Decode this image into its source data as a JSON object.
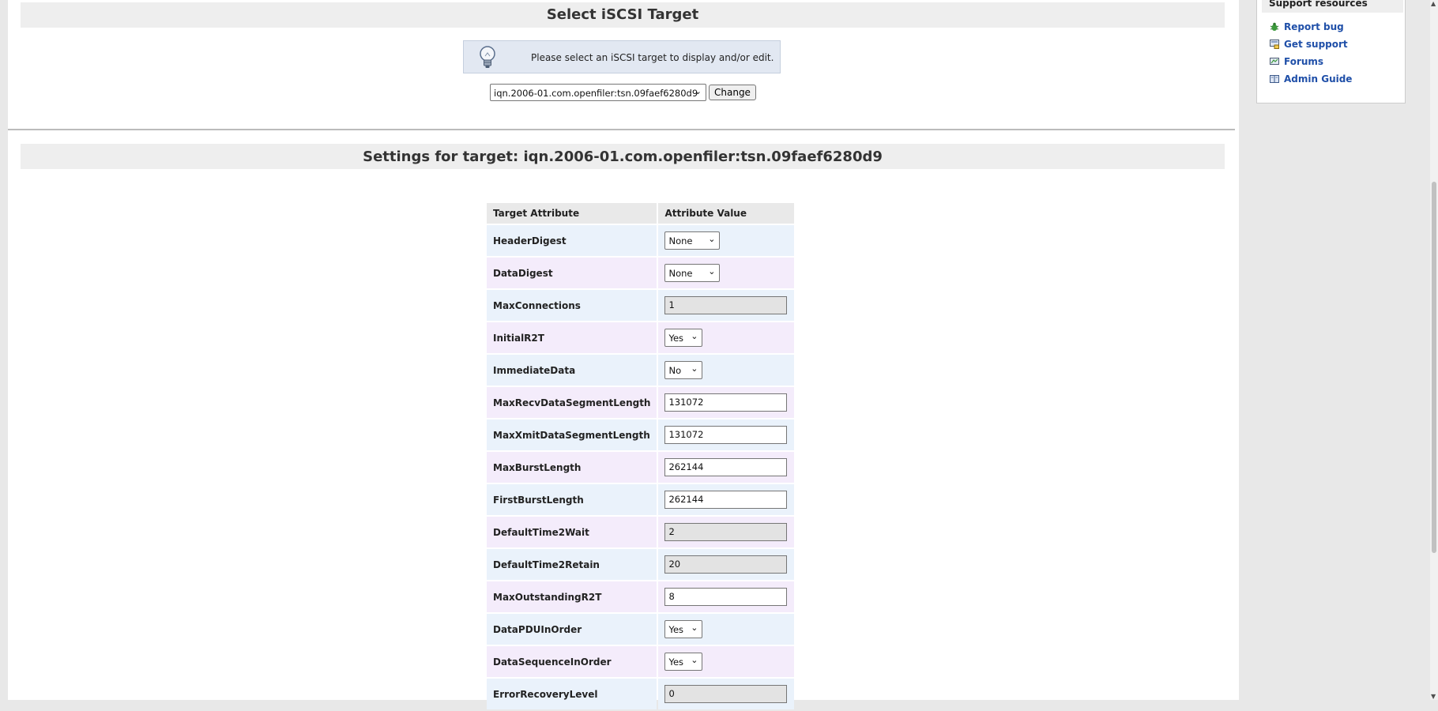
{
  "select_section": {
    "title": "Select iSCSI Target",
    "info": "Please select an iSCSI target to display and/or edit.",
    "target_value": "iqn.2006-01.com.openfiler:tsn.09faef6280d9",
    "change_label": "Change"
  },
  "settings_section": {
    "title": "Settings for target: iqn.2006-01.com.openfiler:tsn.09faef6280d9"
  },
  "table": {
    "headers": [
      "Target Attribute",
      "Attribute Value"
    ],
    "rows": [
      {
        "label": "HeaderDigest",
        "type": "select",
        "value": "None"
      },
      {
        "label": "DataDigest",
        "type": "select",
        "value": "None"
      },
      {
        "label": "MaxConnections",
        "type": "readonly",
        "value": "1"
      },
      {
        "label": "InitialR2T",
        "type": "select",
        "value": "Yes"
      },
      {
        "label": "ImmediateData",
        "type": "select",
        "value": "No"
      },
      {
        "label": "MaxRecvDataSegmentLength",
        "type": "input",
        "value": "131072"
      },
      {
        "label": "MaxXmitDataSegmentLength",
        "type": "input",
        "value": "131072"
      },
      {
        "label": "MaxBurstLength",
        "type": "input",
        "value": "262144"
      },
      {
        "label": "FirstBurstLength",
        "type": "input",
        "value": "262144"
      },
      {
        "label": "DefaultTime2Wait",
        "type": "readonly",
        "value": "2"
      },
      {
        "label": "DefaultTime2Retain",
        "type": "readonly",
        "value": "20"
      },
      {
        "label": "MaxOutstandingR2T",
        "type": "input",
        "value": "8"
      },
      {
        "label": "DataPDUInOrder",
        "type": "select",
        "value": "Yes"
      },
      {
        "label": "DataSequenceInOrder",
        "type": "select",
        "value": "Yes"
      },
      {
        "label": "ErrorRecoveryLevel",
        "type": "readonly",
        "value": "0"
      }
    ]
  },
  "sidebar": {
    "title": "Support resources",
    "links": [
      {
        "label": "Report bug",
        "icon": "bug-icon"
      },
      {
        "label": "Get support",
        "icon": "support-icon"
      },
      {
        "label": "Forums",
        "icon": "forums-icon"
      },
      {
        "label": "Admin Guide",
        "icon": "book-icon"
      }
    ]
  },
  "colors": {
    "row_even": "#eaf2fb",
    "row_odd": "#f4ecfb",
    "link": "#1f4fa8",
    "header_bg": "#eeeeee"
  }
}
